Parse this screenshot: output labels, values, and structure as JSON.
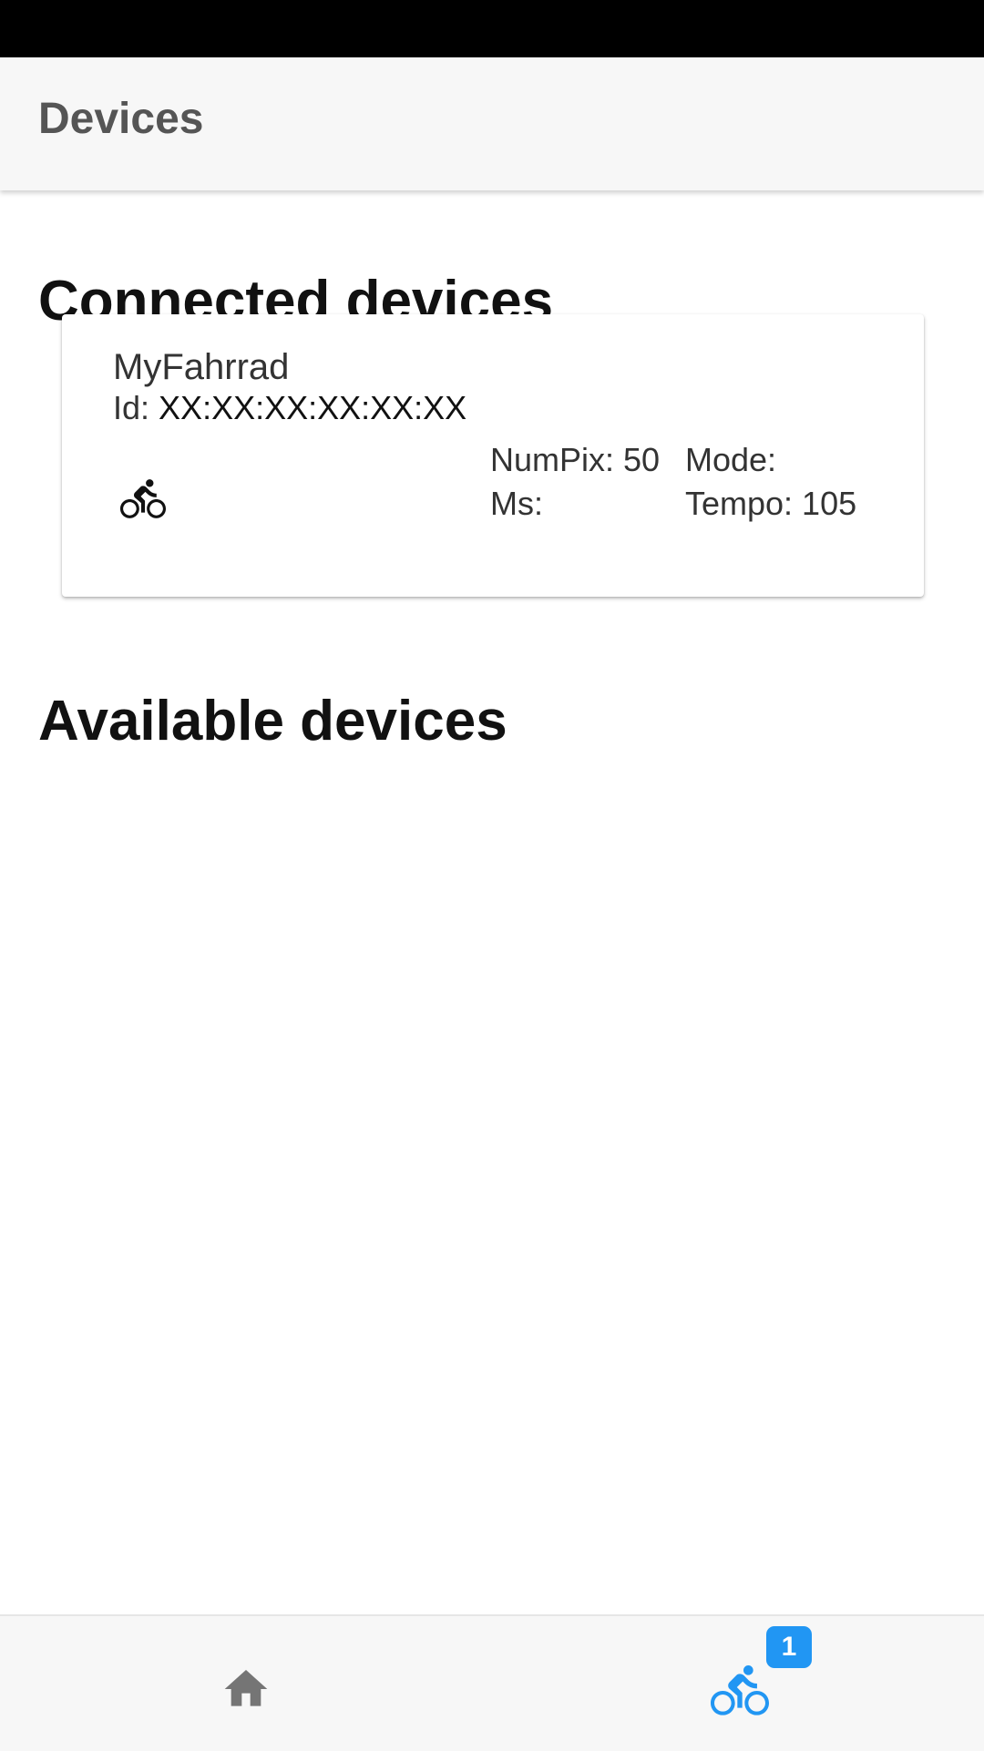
{
  "app_bar": {
    "title": "Devices"
  },
  "sections": {
    "connected_title": "Connected devices",
    "available_title": "Available devices"
  },
  "connected_devices": [
    {
      "name": "MyFahrrad",
      "id_label": "Id:",
      "id_value": "XX:XX:XX:XX:XX:XX",
      "icon": "bike-icon",
      "stats": {
        "numpix": "NumPix: 50",
        "ms": "Ms:",
        "mode": "Mode:",
        "tempo": "Tempo: 105"
      }
    }
  ],
  "available_devices": [],
  "bottom_nav": {
    "items": [
      {
        "icon": "home-icon",
        "active": false
      },
      {
        "icon": "bike-icon",
        "active": true,
        "badge": "1"
      }
    ]
  },
  "colors": {
    "accent": "#2196f3",
    "inactive_icon": "#757575",
    "app_bar_bg": "#f7f7f7",
    "status_bar": "#000000"
  }
}
